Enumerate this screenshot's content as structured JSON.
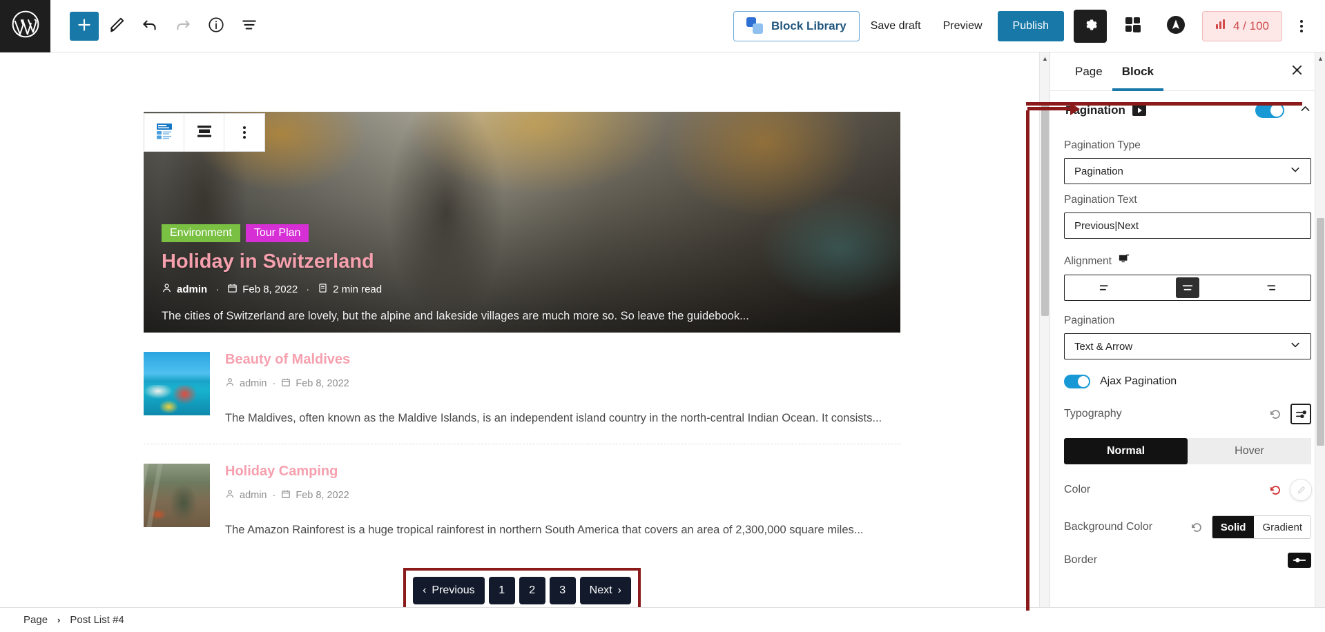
{
  "topbar": {
    "logo_icon": "wordpress-logo-icon",
    "tools": [
      {
        "name": "add-block-button",
        "icon": "plus-icon"
      },
      {
        "name": "edit-tool-button",
        "icon": "pencil-icon"
      },
      {
        "name": "undo-button",
        "icon": "undo-arrow-icon"
      },
      {
        "name": "redo-button",
        "icon": "redo-arrow-icon"
      },
      {
        "name": "details-button",
        "icon": "info-circle-icon"
      },
      {
        "name": "list-view-button",
        "icon": "list-view-icon"
      }
    ],
    "block_library_label": "Block Library",
    "save_draft_label": "Save draft",
    "preview_label": "Preview",
    "publish_label": "Publish",
    "settings_icon": "gear-icon",
    "blocks_icon": "blocks-stack-icon",
    "brand_icon": "astra-logo-icon",
    "score_label": "4 / 100",
    "score_icon": "seo-score-icon",
    "more_icon": "kebab-menu-icon"
  },
  "block_toolbar": {
    "items": [
      {
        "name": "post-list-block-icon",
        "icon": "post-list-icon"
      },
      {
        "name": "align-wide-button",
        "icon": "align-bars-icon"
      },
      {
        "name": "block-options-button",
        "icon": "kebab-menu-icon"
      }
    ]
  },
  "hero": {
    "tags": [
      {
        "label": "Environment",
        "color": "#7ac143"
      },
      {
        "label": "Tour Plan",
        "color": "#d62fd6"
      }
    ],
    "title": "Holiday in Switzerland",
    "author_icon": "user-icon",
    "author": "admin",
    "date_icon": "calendar-icon",
    "date": "Feb 8, 2022",
    "read_icon": "read-time-icon",
    "read_time": "2 min read",
    "excerpt": "The cities of Switzerland are lovely, but the alpine and lakeside villages are much more so. So leave the guidebook..."
  },
  "posts": [
    {
      "thumb": "maldives-thumbnail",
      "title": "Beauty of Maldives",
      "author_icon": "user-icon",
      "author": "admin",
      "date_icon": "calendar-icon",
      "date": "Feb 8, 2022",
      "excerpt": "The Maldives, often known as the Maldive Islands, is an independent island country in the north-central Indian Ocean. It consists..."
    },
    {
      "thumb": "camping-thumbnail",
      "title": "Holiday Camping",
      "author_icon": "user-icon",
      "author": "admin",
      "date_icon": "calendar-icon",
      "date": "Feb 8, 2022",
      "excerpt": "The Amazon Rainforest is a huge tropical rainforest in northern South America that covers an area of 2,300,000 square miles..."
    }
  ],
  "pagination_preview": {
    "previous_label": "Previous",
    "next_label": "Next",
    "pages": [
      "1",
      "2",
      "3"
    ],
    "prev_arrow": "‹",
    "next_arrow": "›",
    "highlight_color": "#8b1a1a"
  },
  "sidebar": {
    "tabs": [
      {
        "label": "Page",
        "active": false
      },
      {
        "label": "Block",
        "active": true
      }
    ],
    "close_icon": "close-icon",
    "panel": {
      "title": "Pagination",
      "video_icon": "video-play-icon",
      "toggle_on": true,
      "collapse_icon": "chevron-up-icon"
    },
    "pagination_type": {
      "label": "Pagination Type",
      "value": "Pagination"
    },
    "pagination_text": {
      "label": "Pagination Text",
      "value": "Previous|Next"
    },
    "alignment": {
      "label": "Alignment",
      "device_icon": "desktop-icon",
      "options": [
        {
          "name": "align-left",
          "active": false
        },
        {
          "name": "align-center",
          "active": true
        },
        {
          "name": "align-right",
          "active": false
        }
      ]
    },
    "pagination_style": {
      "label": "Pagination",
      "value": "Text & Arrow"
    },
    "ajax": {
      "label": "Ajax Pagination",
      "on": true
    },
    "typography": {
      "label": "Typography",
      "reset_icon": "reset-icon",
      "settings_icon": "typography-settings-icon"
    },
    "state_tabs": [
      {
        "label": "Normal",
        "active": true
      },
      {
        "label": "Hover",
        "active": false
      }
    ],
    "color": {
      "label": "Color",
      "reset_icon": "reset-icon",
      "swatch_icon": "color-picker-icon"
    },
    "background_color": {
      "label": "Background Color",
      "reset_icon": "reset-icon",
      "options": [
        {
          "label": "Solid",
          "active": true
        },
        {
          "label": "Gradient",
          "active": false
        }
      ]
    },
    "border": {
      "label": "Border",
      "icon": "border-settings-icon"
    }
  },
  "statusbar": {
    "breadcrumb": [
      "Page",
      "Post List #4"
    ],
    "separator": "›"
  }
}
